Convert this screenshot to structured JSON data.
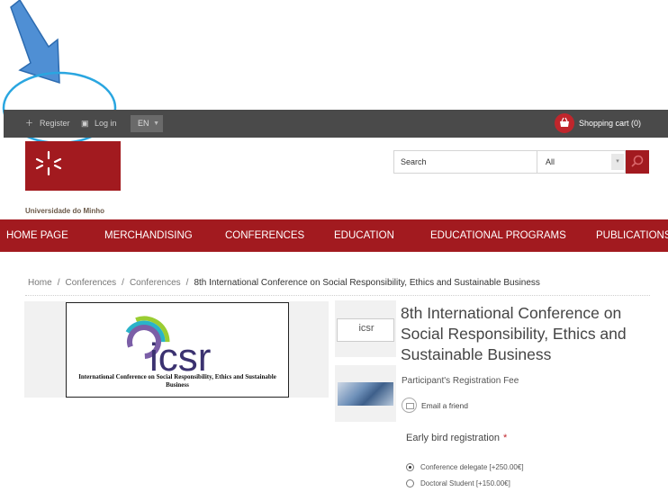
{
  "topbar": {
    "register_label": "Register",
    "login_label": "Log in",
    "language": "EN",
    "cart_label": "Shopping cart (0)"
  },
  "header": {
    "university_name": "Universidade do Minho",
    "search_placeholder": "Search",
    "search_category": "All"
  },
  "nav": {
    "items": [
      "HOME PAGE",
      "MERCHANDISING",
      "CONFERENCES",
      "EDUCATION",
      "EDUCATIONAL PROGRAMS",
      "PUBLICATIONS"
    ]
  },
  "breadcrumb": {
    "items": [
      "Home",
      "Conferences",
      "Conferences"
    ],
    "current": "8th International Conference on Social Responsibility, Ethics and Sustainable Business"
  },
  "product": {
    "logo_text": "icsr",
    "logo_caption": "International Conference on Social Responsibility, Ethics and Sustainable Business",
    "thumb_logo_text": "icsr",
    "title": "8th International Conference on Social Responsibility, Ethics and Sustainable Business",
    "short_description": "Participant's Registration Fee",
    "email_friend_label": "Email a friend",
    "attribute_label": "Early bird registration",
    "required_mark": "*",
    "options": [
      {
        "label": "Conference delegate [+250.00€]",
        "selected": true
      },
      {
        "label": "Doctoral Student [+150.00€]",
        "selected": false
      }
    ]
  },
  "colors": {
    "brand_red": "#a21a1f",
    "topbar": "#4a4a4a",
    "annotation_blue": "#3d8fd6"
  }
}
